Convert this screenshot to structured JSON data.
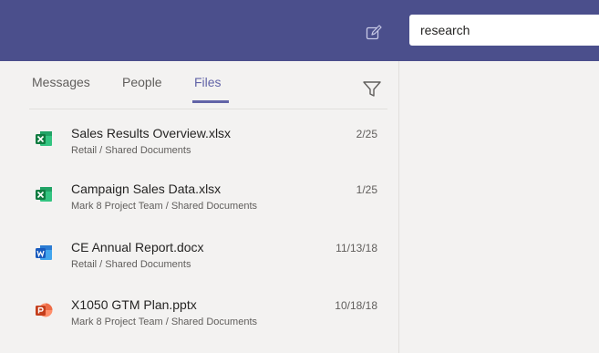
{
  "search": {
    "value": "research"
  },
  "tabs": [
    {
      "label": "Messages",
      "active": false
    },
    {
      "label": "People",
      "active": false
    },
    {
      "label": "Files",
      "active": true
    }
  ],
  "results": [
    {
      "name": "Sales Results Overview.xlsx",
      "path": "Retail / Shared Documents",
      "date": "2/25",
      "icon": "excel-icon"
    },
    {
      "name": "Campaign Sales Data.xlsx",
      "path": "Mark 8 Project Team / Shared Documents",
      "date": "1/25",
      "icon": "excel-icon"
    },
    {
      "name": "CE Annual Report.docx",
      "path": "Retail / Shared Documents",
      "date": "11/13/18",
      "icon": "word-icon"
    },
    {
      "name": "X1050 GTM Plan.pptx",
      "path": "Mark 8 Project Team / Shared Documents",
      "date": "10/18/18",
      "icon": "powerpoint-icon"
    }
  ],
  "colors": {
    "header": "#4b4f8c",
    "accent": "#6264a7",
    "excel": "#217346",
    "word": "#2b7cd3",
    "powerpoint": "#d24726"
  }
}
